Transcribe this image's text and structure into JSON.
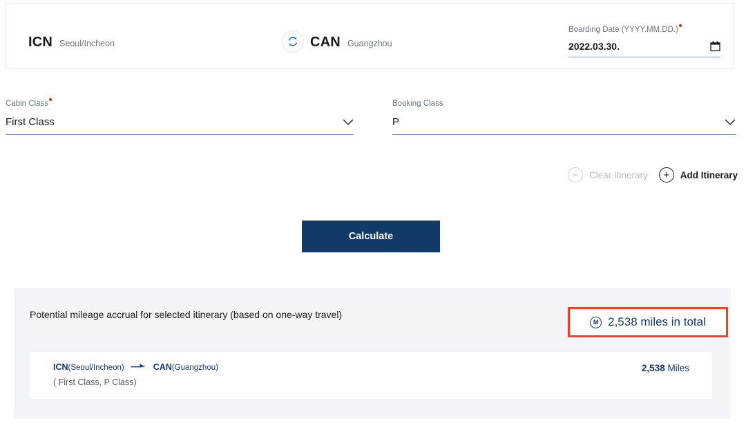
{
  "route": {
    "origin": {
      "code": "ICN",
      "city": "Seoul/Incheon"
    },
    "destination": {
      "code": "CAN",
      "city": "Guangzhou"
    },
    "swap_icon": "swap-refresh-icon"
  },
  "boarding_date": {
    "label": "Boarding Date (YYYY.MM.DD.)",
    "required": true,
    "value": "2022.03.30.",
    "placeholder": "YYYY.MM.DD.",
    "icon": "calendar-icon"
  },
  "cabin_class": {
    "label": "Cabin Class",
    "required": true,
    "value": "First Class"
  },
  "booking_class": {
    "label": "Booking Class",
    "required": false,
    "value": "P"
  },
  "itinerary_actions": {
    "clear": {
      "label": "Clear Itinerary",
      "icon": "minus-circle-icon",
      "disabled": true
    },
    "add": {
      "label": "Add Itinerary",
      "icon": "plus-circle-icon",
      "disabled": false
    }
  },
  "calculate_button": {
    "label": "Calculate"
  },
  "result": {
    "headline": "Potential mileage accrual for selected itinerary (based on one-way travel)",
    "total": {
      "badge": "M",
      "text": "2,538 miles in total",
      "highlight_color": "#f4401e",
      "text_color": "#14377d"
    },
    "segments": [
      {
        "origin_code": "ICN",
        "origin_city": "(Seoul/Incheon)",
        "arrow_icon": "flight-arrow-icon",
        "destination_code": "CAN",
        "destination_city": "(Guangzhou)",
        "classes": "( First Class, P Class)",
        "miles_value": "2,538",
        "miles_unit": "Miles"
      }
    ]
  },
  "theme": {
    "primary_navy": "#113a68",
    "accent_blue": "#14377d",
    "required_red": "#e2231a",
    "highlight_red": "#f4401e",
    "panel_bg": "#f2f4f8"
  }
}
